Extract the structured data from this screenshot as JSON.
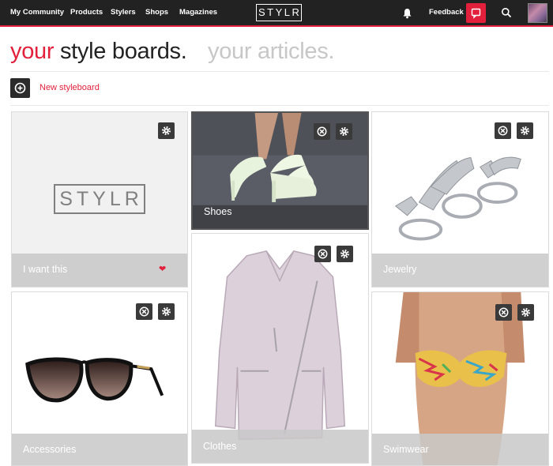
{
  "nav": {
    "links": [
      "My Community",
      "Products",
      "Stylers",
      "Shops",
      "Magazines"
    ],
    "logo": "STYLR",
    "feedback": "Feedback",
    "bell_icon": "bell-icon",
    "search_icon": "search-icon"
  },
  "tabs": {
    "boards_accent": "your",
    "boards_rest": " style boards.",
    "articles": "your articles."
  },
  "actions": {
    "new_board": "New styleboard"
  },
  "boards": [
    {
      "label": "I want this",
      "thumb_text": "STYLR"
    },
    {
      "label": "Shoes"
    },
    {
      "label": "Jewelry"
    },
    {
      "label": "Accessories"
    },
    {
      "label": "Clothes"
    },
    {
      "label": "Swimwear"
    }
  ],
  "colors": {
    "accent": "#e2203b",
    "topbar": "#222222"
  }
}
